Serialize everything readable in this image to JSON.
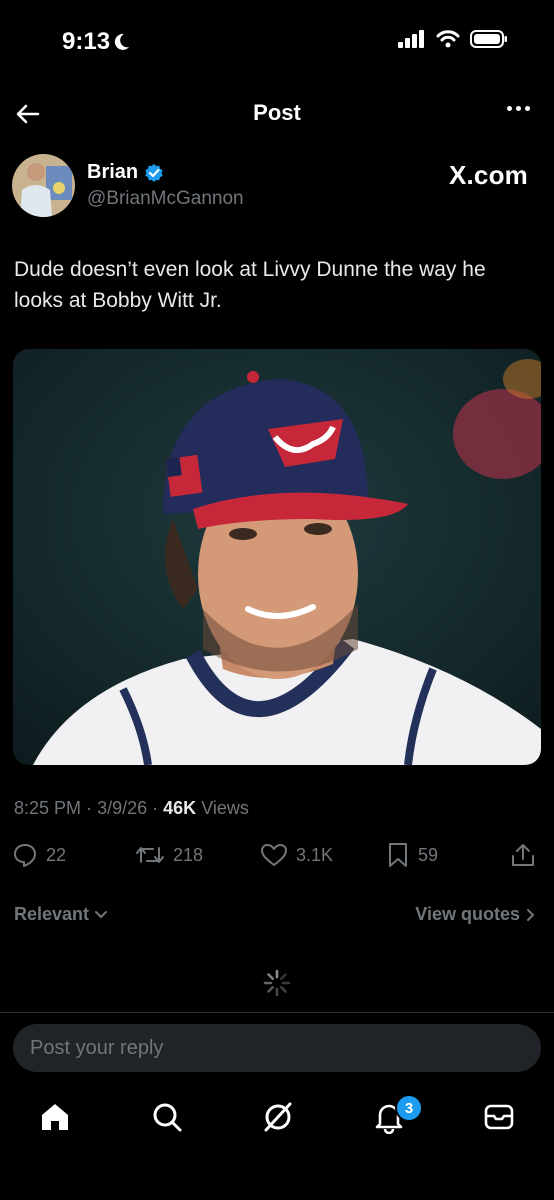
{
  "status": {
    "time": "9:13"
  },
  "header": {
    "title": "Post"
  },
  "author": {
    "name": "Brian",
    "handle": "@BrianMcGannon",
    "badge_color": "#1d9bf0"
  },
  "watermark": "X.com",
  "tweet": {
    "text": "Dude doesn’t even look at Livvy Dunne the way he looks at Bobby Witt Jr."
  },
  "meta": {
    "time": "8:25 PM",
    "date": "3/9/26",
    "views_count": "46K",
    "views_label": "Views",
    "sep": "·"
  },
  "actions": {
    "replies": "22",
    "reposts": "218",
    "likes": "3.1K",
    "bookmarks": "59"
  },
  "filter": {
    "label": "Relevant",
    "view_quotes": "View quotes"
  },
  "reply_box": {
    "placeholder": "Post your reply"
  },
  "nav": {
    "notifications_badge": "3"
  }
}
